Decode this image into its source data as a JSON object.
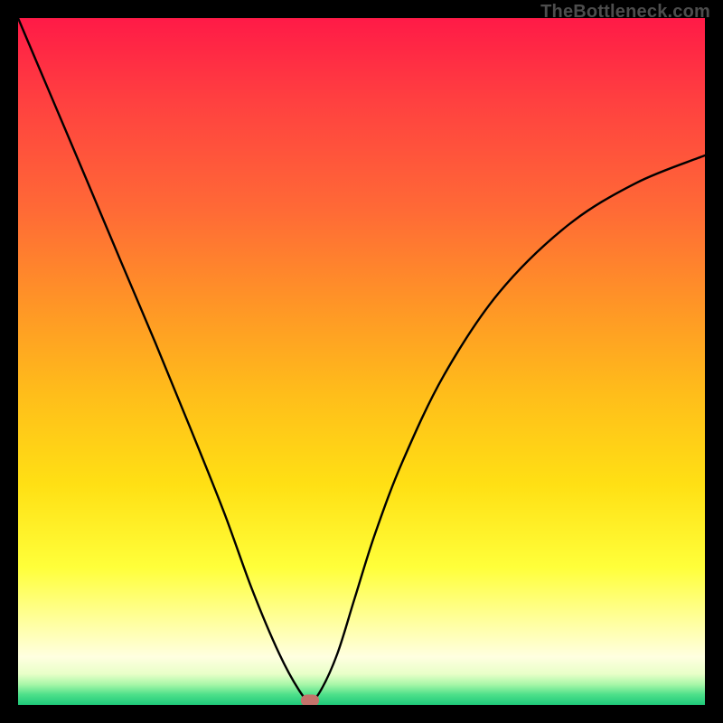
{
  "watermark": "TheBottleneck.com",
  "chart_data": {
    "type": "line",
    "title": "",
    "xlabel": "",
    "ylabel": "",
    "xlim": [
      0,
      1
    ],
    "ylim": [
      0,
      1
    ],
    "grid": false,
    "legend": false,
    "background_gradient": {
      "direction": "top-to-bottom",
      "stops": [
        {
          "pos": 0.0,
          "color": "#ff1a47"
        },
        {
          "pos": 0.12,
          "color": "#ff4040"
        },
        {
          "pos": 0.28,
          "color": "#ff6a36"
        },
        {
          "pos": 0.42,
          "color": "#ff9626"
        },
        {
          "pos": 0.55,
          "color": "#ffbe1a"
        },
        {
          "pos": 0.68,
          "color": "#ffe014"
        },
        {
          "pos": 0.8,
          "color": "#ffff3a"
        },
        {
          "pos": 0.88,
          "color": "#ffffa0"
        },
        {
          "pos": 0.93,
          "color": "#ffffe0"
        },
        {
          "pos": 0.955,
          "color": "#e8ffc8"
        },
        {
          "pos": 0.97,
          "color": "#a8f7a8"
        },
        {
          "pos": 0.985,
          "color": "#4de08a"
        },
        {
          "pos": 1.0,
          "color": "#1fc97a"
        }
      ]
    },
    "series": [
      {
        "name": "curve",
        "x": [
          0.0,
          0.05,
          0.1,
          0.15,
          0.2,
          0.25,
          0.3,
          0.34,
          0.38,
          0.41,
          0.425,
          0.44,
          0.465,
          0.49,
          0.52,
          0.56,
          0.62,
          0.7,
          0.8,
          0.9,
          1.0
        ],
        "y": [
          1.0,
          0.882,
          0.764,
          0.645,
          0.527,
          0.405,
          0.28,
          0.17,
          0.075,
          0.02,
          0.006,
          0.02,
          0.075,
          0.155,
          0.25,
          0.355,
          0.48,
          0.6,
          0.698,
          0.76,
          0.8
        ]
      }
    ],
    "marker": {
      "x": 0.425,
      "y": 0.006,
      "color": "#c4736b"
    },
    "note": "x/y are normalized 0–1 within the plot area; y=0 is bottom (green), y=1 is top (red)."
  }
}
